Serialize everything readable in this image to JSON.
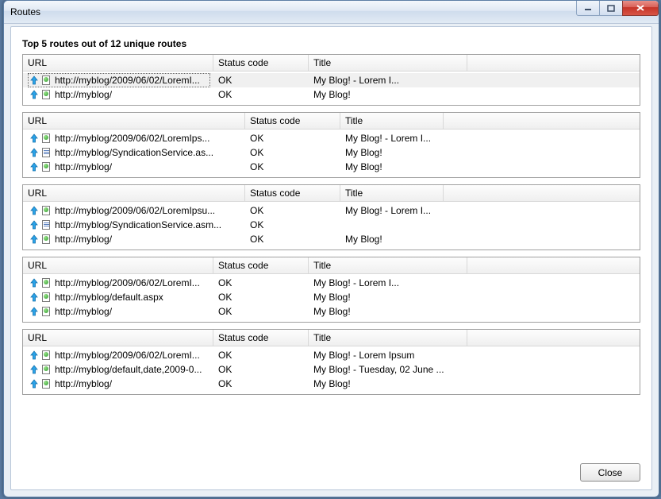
{
  "window": {
    "title": "Routes"
  },
  "heading": "Top 5 routes out of 12 unique routes",
  "columns": {
    "url": "URL",
    "status": "Status code",
    "title": "Title"
  },
  "footer": {
    "close": "Close"
  },
  "groups": [
    {
      "wide": false,
      "rows": [
        {
          "selected": true,
          "icon": "html",
          "url": "http://myblog/2009/06/02/LoremI...",
          "status": "OK",
          "title": "My Blog! - Lorem I..."
        },
        {
          "selected": false,
          "icon": "html",
          "url": "http://myblog/",
          "status": "OK",
          "title": "My Blog!"
        }
      ]
    },
    {
      "wide": true,
      "rows": [
        {
          "selected": false,
          "icon": "html",
          "url": "http://myblog/2009/06/02/LoremIps...",
          "status": "OK",
          "title": "My Blog! - Lorem I..."
        },
        {
          "selected": false,
          "icon": "feed",
          "url": "http://myblog/SyndicationService.as...",
          "status": "OK",
          "title": "My Blog!"
        },
        {
          "selected": false,
          "icon": "html",
          "url": "http://myblog/",
          "status": "OK",
          "title": "My Blog!"
        }
      ]
    },
    {
      "wide": true,
      "rows": [
        {
          "selected": false,
          "icon": "html",
          "url": "http://myblog/2009/06/02/LoremIpsu...",
          "status": "OK",
          "title": "My Blog! - Lorem I..."
        },
        {
          "selected": false,
          "icon": "feed",
          "url": "http://myblog/SyndicationService.asm...",
          "status": "OK",
          "title": ""
        },
        {
          "selected": false,
          "icon": "html",
          "url": "http://myblog/",
          "status": "OK",
          "title": "My Blog!"
        }
      ]
    },
    {
      "wide": false,
      "rows": [
        {
          "selected": false,
          "icon": "html",
          "url": "http://myblog/2009/06/02/LoremI...",
          "status": "OK",
          "title": "My Blog! - Lorem I..."
        },
        {
          "selected": false,
          "icon": "html",
          "url": "http://myblog/default.aspx",
          "status": "OK",
          "title": "My Blog!"
        },
        {
          "selected": false,
          "icon": "html",
          "url": "http://myblog/",
          "status": "OK",
          "title": "My Blog!"
        }
      ]
    },
    {
      "wide": false,
      "rows": [
        {
          "selected": false,
          "icon": "html",
          "url": "http://myblog/2009/06/02/LoremI...",
          "status": "OK",
          "title": "My Blog! - Lorem Ipsum"
        },
        {
          "selected": false,
          "icon": "html",
          "url": "http://myblog/default,date,2009-0...",
          "status": "OK",
          "title": "My Blog! - Tuesday, 02 June ..."
        },
        {
          "selected": false,
          "icon": "html",
          "url": "http://myblog/",
          "status": "OK",
          "title": "My Blog!"
        }
      ]
    }
  ]
}
